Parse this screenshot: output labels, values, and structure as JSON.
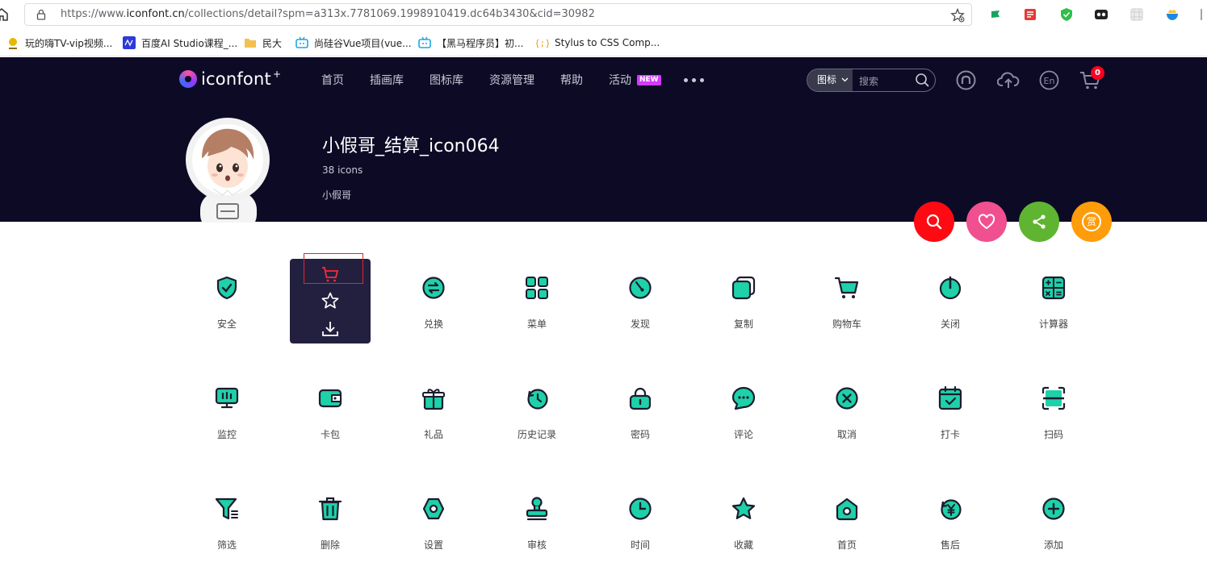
{
  "browser": {
    "url_prefix": "https://www.",
    "url_host": "iconfont.cn",
    "url_rest": "/collections/detail?spm=a313x.7781069.1998910419.dc64b3430&cid=30982",
    "bookmarks": [
      {
        "label": "玩的嗨TV-vip视频...",
        "color": "#e6b800"
      },
      {
        "label": "百度AI Studio课程_...",
        "color": "#2b3bd9"
      },
      {
        "label": "民大",
        "color": "#f2c14e"
      },
      {
        "label": "尚硅谷Vue项目(vue...",
        "color": "#1fa6e0"
      },
      {
        "label": "【黑马程序员】初...",
        "color": "#1fa6e0"
      },
      {
        "label": "Stylus to CSS Comp...",
        "color": "#f59e0b"
      }
    ]
  },
  "header": {
    "logo_text": "iconfont",
    "logo_plus": "+",
    "nav": [
      {
        "label": "首页"
      },
      {
        "label": "插画库"
      },
      {
        "label": "图标库"
      },
      {
        "label": "资源管理"
      },
      {
        "label": "帮助"
      },
      {
        "label": "活动"
      }
    ],
    "new_badge": "NEW",
    "search_type": "图标",
    "search_placeholder": "搜索",
    "cart_count": "0"
  },
  "collection": {
    "title": "小假哥_结算_icon064",
    "count": "38 icons",
    "author": "小假哥"
  },
  "colors": {
    "accent": "#1ed1a8",
    "dark": "#1c1c2e",
    "search_fab": "#ff0a12",
    "like_fab": "#f0508f",
    "share_fab": "#5fb532",
    "reward_fab": "#ff9c0a"
  },
  "fab_reward_glyph": "赏",
  "icons": [
    {
      "label": "安全",
      "icon": "shield-check-icon"
    },
    {
      "label": "",
      "icon": "cart-icon"
    },
    {
      "label": "兑换",
      "icon": "exchange-icon"
    },
    {
      "label": "菜单",
      "icon": "menu-grid-icon"
    },
    {
      "label": "发现",
      "icon": "compass-icon"
    },
    {
      "label": "复制",
      "icon": "copy-icon"
    },
    {
      "label": "购物车",
      "icon": "shopping-cart-icon"
    },
    {
      "label": "关闭",
      "icon": "power-icon"
    },
    {
      "label": "计算器",
      "icon": "calculator-icon"
    },
    {
      "label": "监控",
      "icon": "monitor-icon"
    },
    {
      "label": "卡包",
      "icon": "wallet-icon"
    },
    {
      "label": "礼品",
      "icon": "gift-icon"
    },
    {
      "label": "历史记录",
      "icon": "history-icon"
    },
    {
      "label": "密码",
      "icon": "lock-icon"
    },
    {
      "label": "评论",
      "icon": "comment-icon"
    },
    {
      "label": "取消",
      "icon": "cancel-icon"
    },
    {
      "label": "打卡",
      "icon": "calendar-check-icon"
    },
    {
      "label": "扫码",
      "icon": "scan-icon"
    },
    {
      "label": "筛选",
      "icon": "filter-icon"
    },
    {
      "label": "删除",
      "icon": "trash-icon"
    },
    {
      "label": "设置",
      "icon": "settings-icon"
    },
    {
      "label": "审核",
      "icon": "stamp-icon"
    },
    {
      "label": "时间",
      "icon": "clock-icon"
    },
    {
      "label": "收藏",
      "icon": "star-icon"
    },
    {
      "label": "首页",
      "icon": "home-icon"
    },
    {
      "label": "售后",
      "icon": "after-sale-icon"
    },
    {
      "label": "添加",
      "icon": "add-icon"
    }
  ]
}
